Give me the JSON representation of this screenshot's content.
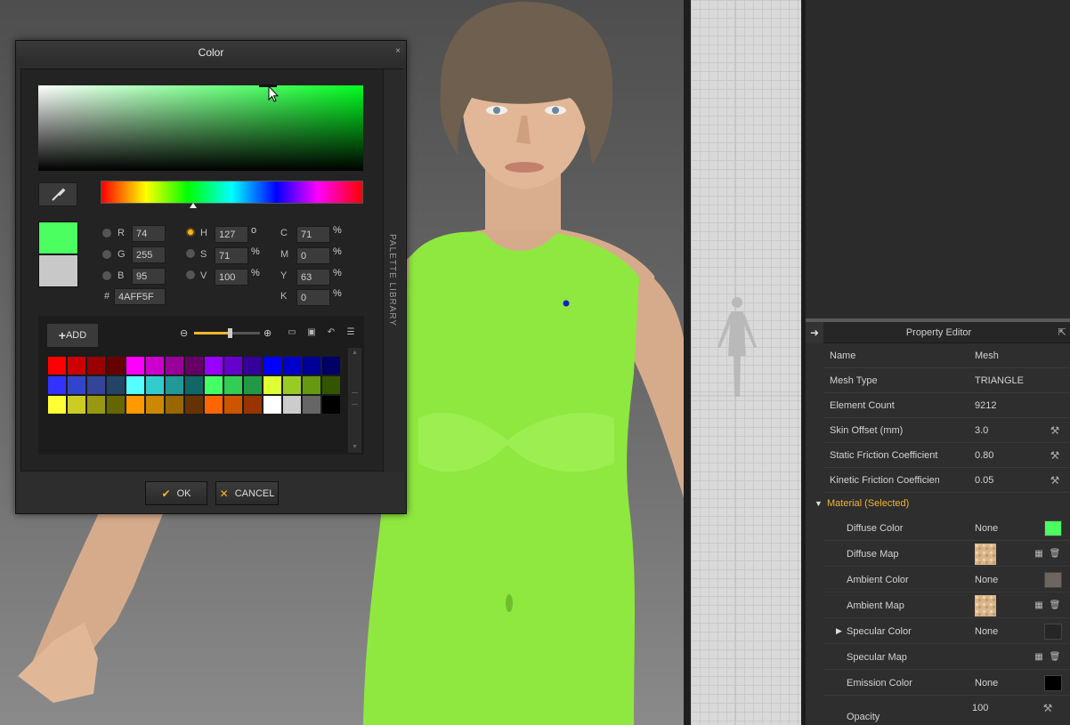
{
  "color_dialog": {
    "title": "Color",
    "close": "×",
    "current_color": "#4AFF5F",
    "previous_color": "#C8C8C8",
    "fields": {
      "r": {
        "label": "R",
        "value": "74"
      },
      "g": {
        "label": "G",
        "value": "255"
      },
      "b": {
        "label": "B",
        "value": "95"
      },
      "h": {
        "label": "H",
        "value": "127",
        "unit": "o"
      },
      "s": {
        "label": "S",
        "value": "71",
        "unit": "%"
      },
      "v": {
        "label": "V",
        "value": "100",
        "unit": "%"
      },
      "c": {
        "label": "C",
        "value": "71",
        "unit": "%"
      },
      "m": {
        "label": "M",
        "value": "0",
        "unit": "%"
      },
      "y": {
        "label": "Y",
        "value": "63",
        "unit": "%"
      },
      "k": {
        "label": "K",
        "value": "0",
        "unit": "%"
      },
      "hex": {
        "label": "#",
        "value": "4AFF5F"
      }
    },
    "selected_mode": "H",
    "palette_add": "ADD",
    "side_tab": "PALETTE  LIBRARY",
    "palette": [
      "#ff0000",
      "#cc0000",
      "#990000",
      "#660000",
      "#ff00ff",
      "#cc00cc",
      "#990099",
      "#660066",
      "#9900ff",
      "#6600cc",
      "#330099",
      "#0000ff",
      "#0000cc",
      "#000099",
      "#000066",
      "#3333ff",
      "#3344cc",
      "#334499",
      "#224466",
      "#55ffff",
      "#33cccc",
      "#229999",
      "#116666",
      "#44ff66",
      "#33cc55",
      "#229944",
      "#ddff33",
      "#99cc22",
      "#669911",
      "#335500",
      "#ffff33",
      "#cccc22",
      "#999911",
      "#666600",
      "#ff9900",
      "#cc8800",
      "#996600",
      "#663300",
      "#ff6600",
      "#cc5500",
      "#993300",
      "#ffffff",
      "#cccccc",
      "#666666",
      "#000000"
    ],
    "ok": "OK",
    "cancel": "CANCEL"
  },
  "property_editor": {
    "title": "Property Editor",
    "rows": [
      {
        "label": "Name",
        "value": "Mesh"
      },
      {
        "label": "Mesh Type",
        "value": "TRIANGLE"
      },
      {
        "label": "Element Count",
        "value": "9212"
      },
      {
        "label": "Skin Offset (mm)",
        "value": "3.0"
      },
      {
        "label": "Static Friction Coefficient",
        "value": "0.80"
      },
      {
        "label": "Kinetic Friction Coefficient",
        "value": "0.05"
      }
    ],
    "material_header": "Material (Selected)",
    "material_rows": [
      {
        "label": "Diffuse Color",
        "value": "None",
        "swatch": "#4AFF5F"
      },
      {
        "label": "Diffuse Map",
        "value": ""
      },
      {
        "label": "Ambient Color",
        "value": "None",
        "swatch": "#6e6460"
      },
      {
        "label": "Ambient Map",
        "value": ""
      },
      {
        "label": "Specular Color",
        "value": "None",
        "swatch": "#262626"
      },
      {
        "label": "Specular Map",
        "value": ""
      },
      {
        "label": "Emission Color",
        "value": "None",
        "swatch": "#000000"
      },
      {
        "label": "Opacity",
        "value": "100"
      }
    ]
  }
}
